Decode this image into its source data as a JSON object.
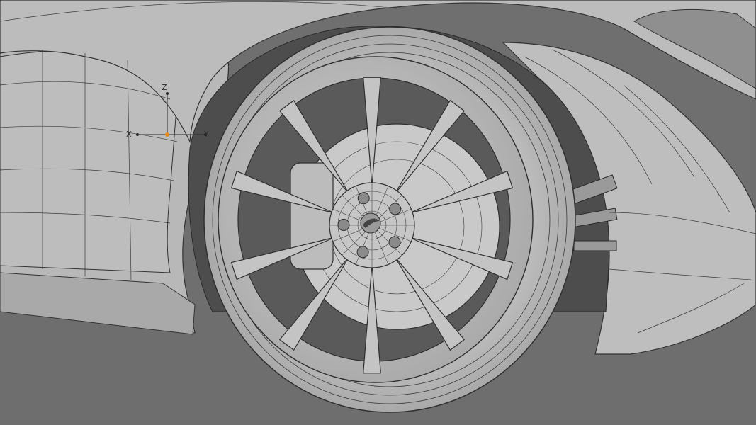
{
  "viewport": {
    "background_color": "#6f6f6f",
    "model_color": "#b9b9b9",
    "wire_color": "#333333"
  },
  "transform_gizmo": {
    "axis_z": "Z",
    "axis_x": "X",
    "axis_y": "Y",
    "origin_color": "#e08a1e"
  },
  "wheel": {
    "spoke_count": 10,
    "lug_nut_count": 5
  }
}
